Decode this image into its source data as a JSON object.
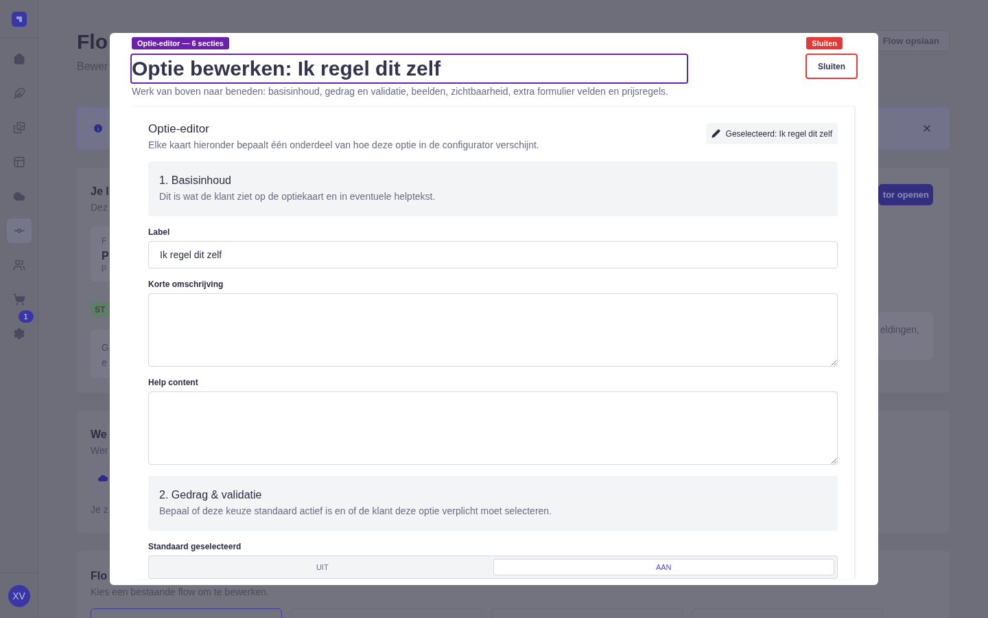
{
  "sidebar": {
    "items": [
      {
        "kind": "home",
        "selected": false
      },
      {
        "kind": "feather",
        "selected": false
      },
      {
        "kind": "images",
        "selected": false
      },
      {
        "kind": "layout",
        "selected": false
      },
      {
        "kind": "cloud",
        "selected": false
      },
      {
        "kind": "flows",
        "selected": true
      },
      {
        "kind": "users",
        "selected": false
      },
      {
        "kind": "cart",
        "selected": false
      },
      {
        "kind": "settings",
        "selected": false,
        "badge": "1"
      }
    ],
    "avatar": "XV"
  },
  "page": {
    "title": "Flo",
    "subtitle": "Bewer",
    "save_button": "Flow opslaan"
  },
  "current_card": {
    "title": "Je l",
    "description": "Dez",
    "flow_box": {
      "label": "F",
      "name": "P",
      "meta": "p"
    },
    "status_badge": "ST",
    "note": [
      "G",
      "e"
    ],
    "open_button": "tor openen",
    "note_right": "eldingen,"
  },
  "web_card": {
    "title": "We",
    "description": "Wer",
    "footer": "Je z"
  },
  "flows_card": {
    "title": "Flo",
    "description": "Kies een bestaande flow om te bewerken.",
    "tiles": [
      {
        "selected": true
      },
      {
        "selected": false
      },
      {
        "selected": false
      },
      {
        "selected": false
      }
    ]
  },
  "modal": {
    "tag": "Optie-editor — 6 secties",
    "title": "Optie bewerken: Ik regel dit zelf",
    "subtitle": "Werk van boven naar beneden: basisinhoud, gedrag en validatie, beelden, zichtbaarheid, extra formulier velden en prijsregels.",
    "close_tag": "Sluiten",
    "close_button": "Sluiten",
    "editor": {
      "title": "Optie-editor",
      "description": "Elke kaart hieronder bepaalt één onderdeel van hoe deze optie in de configurator verschijnt.",
      "selected_pill": "Geselecteerd: Ik regel dit zelf",
      "blocks": [
        {
          "kind": "section",
          "title": "1. Basisinhoud",
          "description": "Dit is wat de klant ziet op de optiekaart en in eventuele helptekst."
        },
        {
          "kind": "input",
          "label": "Label",
          "value": "Ik regel dit zelf"
        },
        {
          "kind": "textarea",
          "label": "Korte omschrijving"
        },
        {
          "kind": "textarea",
          "label": "Help content"
        },
        {
          "kind": "section",
          "title": "2. Gedrag & validatie",
          "description": "Bepaal of deze keuze standaard actief is en of de klant deze optie verplicht moet selecteren."
        },
        {
          "kind": "toggle",
          "label": "Standaard geselecteerd",
          "options": [
            {
              "label": "UIT",
              "selected": false
            },
            {
              "label": "AAN",
              "selected": true
            }
          ]
        }
      ]
    }
  }
}
